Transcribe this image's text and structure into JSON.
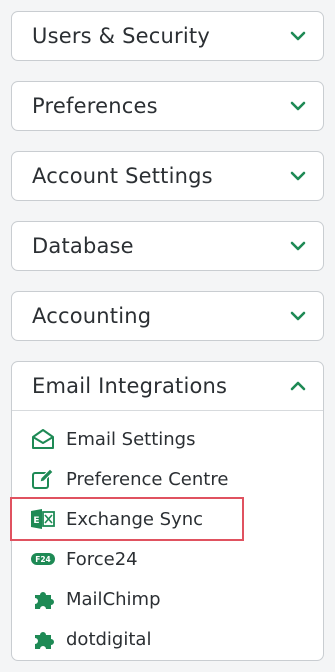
{
  "accent_color": "#1e8a55",
  "highlight_color": "#e05260",
  "sections": [
    {
      "label": "Users & Security",
      "icon": "chevron-down-icon"
    },
    {
      "label": "Preferences",
      "icon": "chevron-down-icon"
    },
    {
      "label": "Account Settings",
      "icon": "chevron-down-icon"
    },
    {
      "label": "Database",
      "icon": "chevron-down-icon"
    },
    {
      "label": "Accounting",
      "icon": "chevron-down-icon"
    }
  ],
  "email_integrations": {
    "label": "Email Integrations",
    "icon": "chevron-up-icon",
    "items": [
      {
        "label": "Email Settings",
        "icon": "envelope-open-icon"
      },
      {
        "label": "Preference Centre",
        "icon": "edit-square-icon"
      },
      {
        "label": "Exchange Sync",
        "icon": "exchange-logo-icon",
        "highlighted": true
      },
      {
        "label": "Force24",
        "icon": "force24-logo-icon",
        "icon_text": "F24"
      },
      {
        "label": "MailChimp",
        "icon": "puzzle-piece-icon"
      },
      {
        "label": "dotdigital",
        "icon": "puzzle-piece-icon"
      }
    ]
  }
}
